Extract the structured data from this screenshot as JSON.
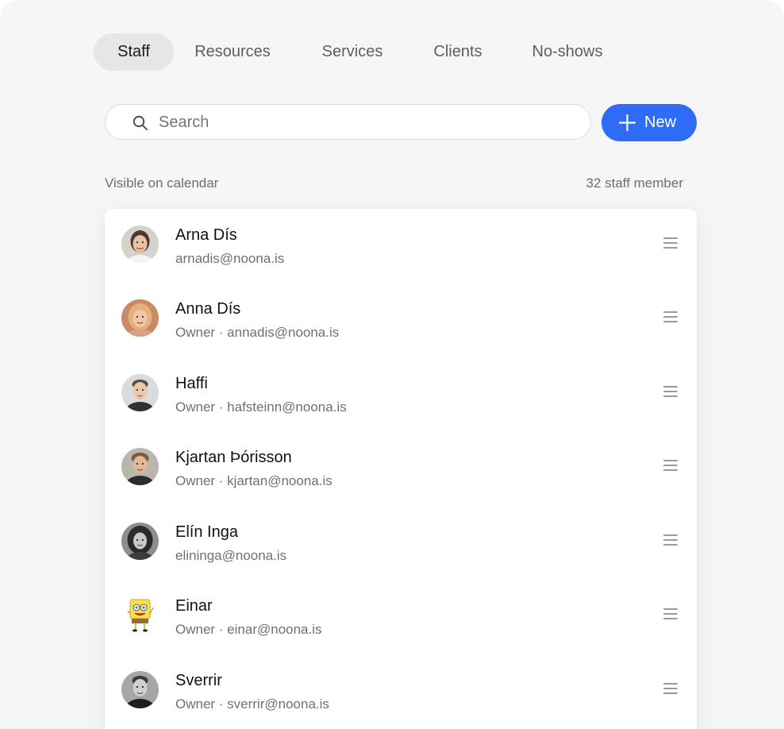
{
  "tabs": [
    {
      "label": "Staff",
      "active": true
    },
    {
      "label": "Resources",
      "active": false
    },
    {
      "label": "Services",
      "active": false
    },
    {
      "label": "Clients",
      "active": false
    },
    {
      "label": "No-shows",
      "active": false
    }
  ],
  "search": {
    "placeholder": "Search",
    "icon": "search-icon"
  },
  "new_button": {
    "label": "New",
    "icon": "plus-icon",
    "color": "#2e6cf6"
  },
  "list_meta": {
    "left": "Visible on calendar",
    "right": "32 staff member"
  },
  "staff": [
    {
      "name": "Arna Dís",
      "detail": "arnadis@noona.is"
    },
    {
      "name": "Anna Dís",
      "detail": "Owner · annadis@noona.is"
    },
    {
      "name": "Haffi",
      "detail": "Owner · hafsteinn@noona.is"
    },
    {
      "name": "Kjartan Þórisson",
      "detail": "Owner · kjartan@noona.is"
    },
    {
      "name": "Elín Inga",
      "detail": "elininga@noona.is"
    },
    {
      "name": "Einar",
      "detail": "Owner · einar@noona.is"
    },
    {
      "name": "Sverrir",
      "detail": "Owner · sverrir@noona.is"
    }
  ],
  "colors": {
    "accent": "#2e6cf6",
    "background": "#f6f6f6",
    "active_tab": "#e6e6e6"
  }
}
